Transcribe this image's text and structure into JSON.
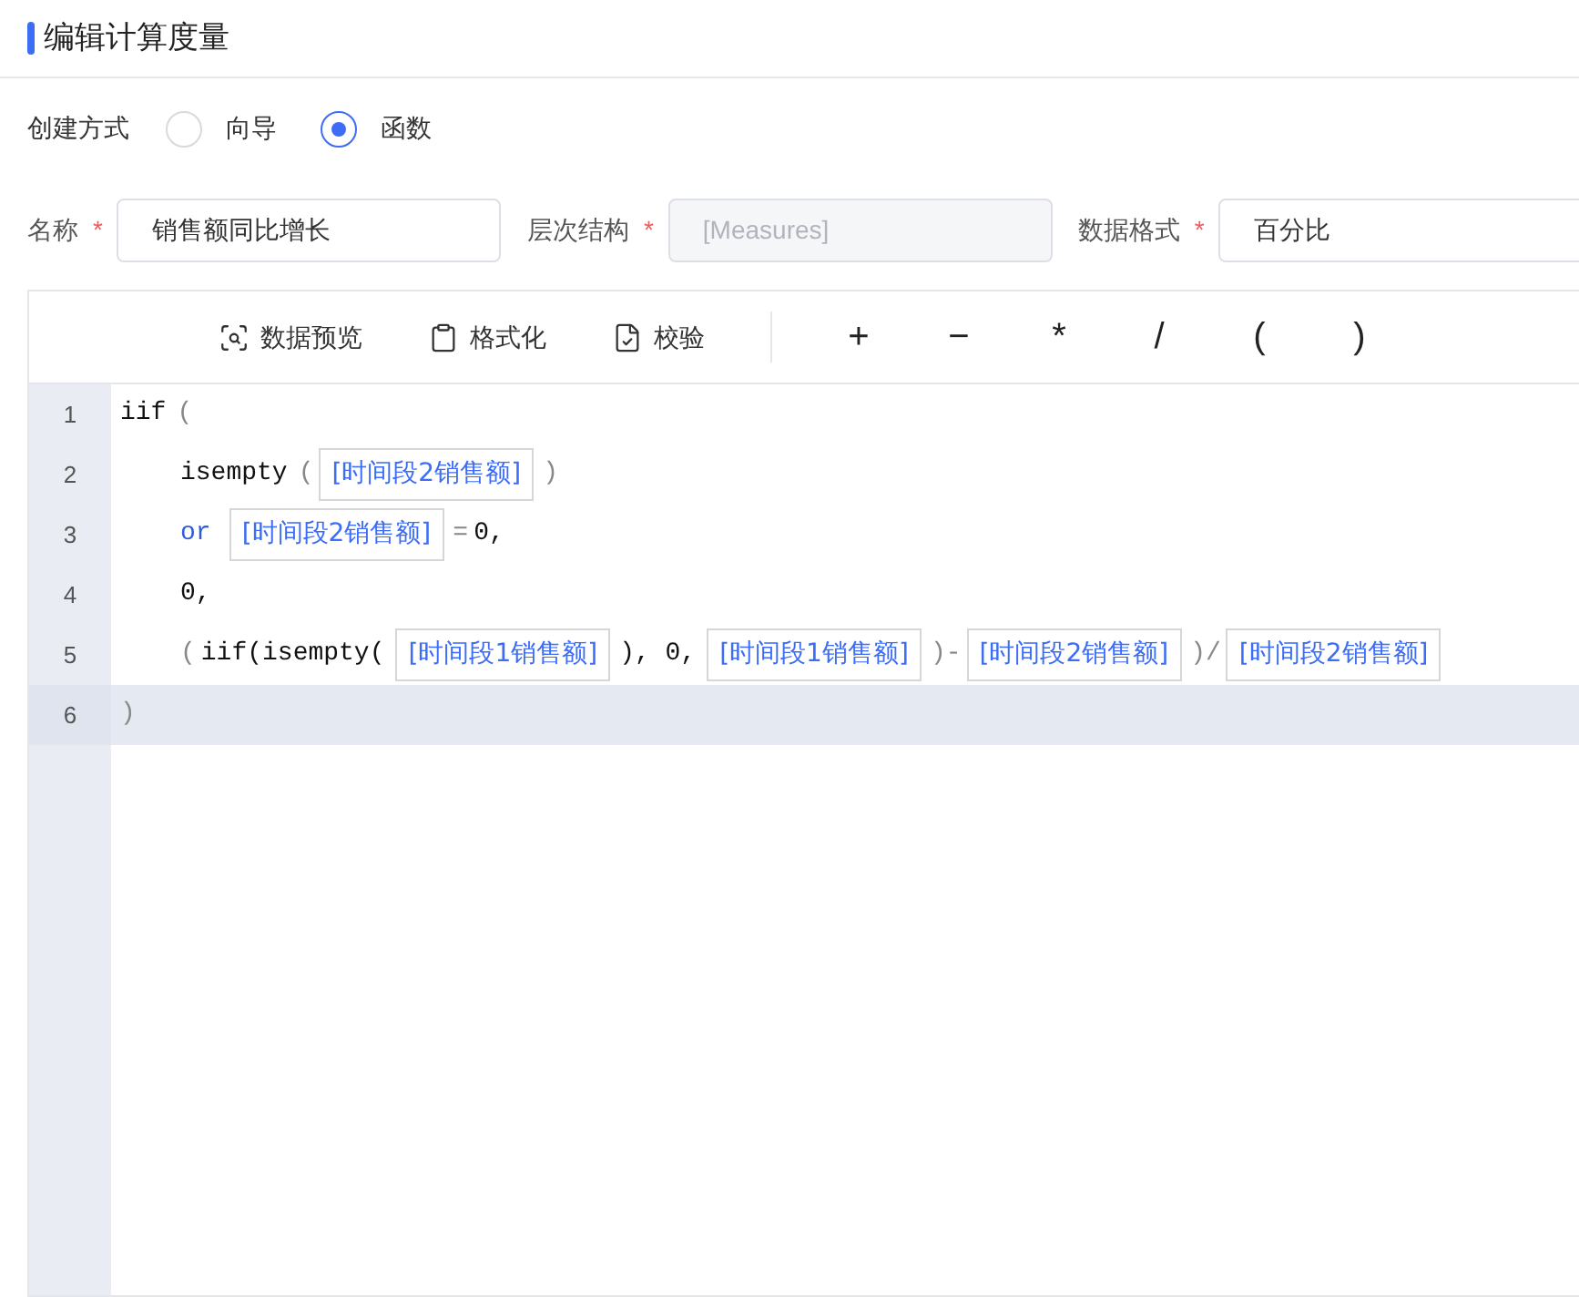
{
  "title": "编辑计算度量",
  "creation_mode": {
    "label": "创建方式",
    "options": [
      {
        "label": "向导",
        "selected": false
      },
      {
        "label": "函数",
        "selected": true
      }
    ]
  },
  "fields": [
    {
      "label": "名称",
      "required": true,
      "value": "销售额同比增长",
      "disabled": false
    },
    {
      "label": "层次结构",
      "required": true,
      "value": "[Measures]",
      "disabled": true
    },
    {
      "label": "数据格式",
      "required": true,
      "value": "百分比",
      "disabled": false
    }
  ],
  "toolbar": {
    "actions": [
      {
        "kind": "preview",
        "label": "数据预览"
      },
      {
        "kind": "format",
        "label": "格式化"
      },
      {
        "kind": "validate",
        "label": "校验"
      }
    ],
    "operators": [
      "+",
      "−",
      "*",
      "/",
      "(",
      ")"
    ]
  },
  "editor": {
    "lines": [
      {
        "number": "1",
        "indented": false,
        "selected": false,
        "tokens": [
          {
            "kind": "text",
            "text": "iif"
          },
          {
            "kind": "punct",
            "text": "("
          }
        ]
      },
      {
        "number": "2",
        "indented": true,
        "selected": false,
        "tokens": [
          {
            "kind": "text",
            "text": "isempty"
          },
          {
            "kind": "punct",
            "text": "("
          },
          {
            "kind": "field",
            "text": "[时间段2销售额]"
          },
          {
            "kind": "punct",
            "text": ")"
          }
        ]
      },
      {
        "number": "3",
        "indented": true,
        "selected": false,
        "tokens": [
          {
            "kind": "keyword",
            "text": "or"
          },
          {
            "kind": "field",
            "text": "[时间段2销售额]"
          },
          {
            "kind": "punct",
            "text": "="
          },
          {
            "kind": "text",
            "text": "0,"
          }
        ]
      },
      {
        "number": "4",
        "indented": true,
        "selected": false,
        "tokens": [
          {
            "kind": "text",
            "text": "0,"
          }
        ]
      },
      {
        "number": "5",
        "indented": true,
        "selected": false,
        "tokens": [
          {
            "kind": "punct",
            "text": "("
          },
          {
            "kind": "text",
            "text": "iif(isempty("
          },
          {
            "kind": "field",
            "text": "[时间段1销售额]"
          },
          {
            "kind": "text",
            "text": "), 0,"
          },
          {
            "kind": "field",
            "text": "[时间段1销售额]"
          },
          {
            "kind": "punct",
            "text": ")-"
          },
          {
            "kind": "field",
            "text": "[时间段2销售额]"
          },
          {
            "kind": "punct",
            "text": ")/"
          },
          {
            "kind": "field",
            "text": "[时间段2销售额]"
          }
        ]
      },
      {
        "number": "6",
        "indented": false,
        "selected": true,
        "tokens": [
          {
            "kind": "punct",
            "text": ")"
          }
        ]
      }
    ]
  }
}
